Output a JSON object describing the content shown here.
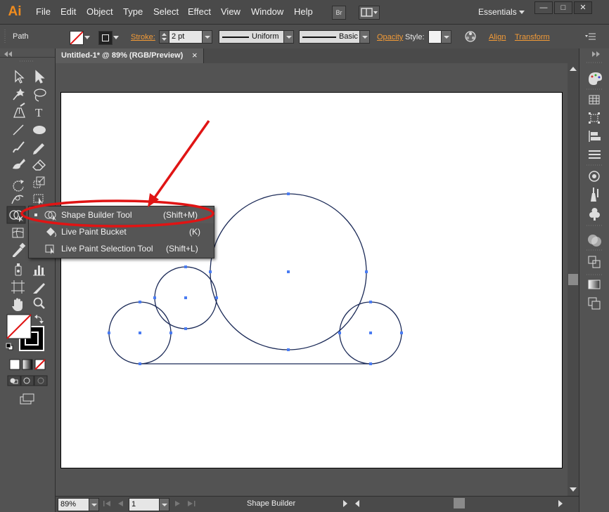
{
  "app": {
    "logo": "Ai",
    "workspace": "Essentials",
    "bridge": "Br"
  },
  "menu": [
    "File",
    "Edit",
    "Object",
    "Type",
    "Select",
    "Effect",
    "View",
    "Window",
    "Help"
  ],
  "control": {
    "selection": "Path",
    "stroke_label": "Stroke:",
    "stroke_weight": "2 pt",
    "profile": "Uniform",
    "brush": "Basic",
    "opacity_label": "Opacity",
    "style_label": "Style:",
    "align_label": "Align",
    "transform_label": "Transform"
  },
  "document": {
    "tab_title": "Untitled-1* @ 89% (RGB/Preview)",
    "close": "×"
  },
  "status": {
    "zoom": "89%",
    "artboard": "1",
    "tool": "Shape Builder"
  },
  "flyout": [
    {
      "label": "Shape Builder Tool",
      "shortcut": "(Shift+M)",
      "selected": true
    },
    {
      "label": "Live Paint Bucket",
      "shortcut": "(K)",
      "selected": false
    },
    {
      "label": "Live Paint Selection Tool",
      "shortcut": "(Shift+L)",
      "selected": false
    }
  ],
  "colors": {
    "accent": "#f39b37",
    "annotation": "#e01414",
    "path": "#1b2a57",
    "anchor": "#4a7cf2"
  }
}
